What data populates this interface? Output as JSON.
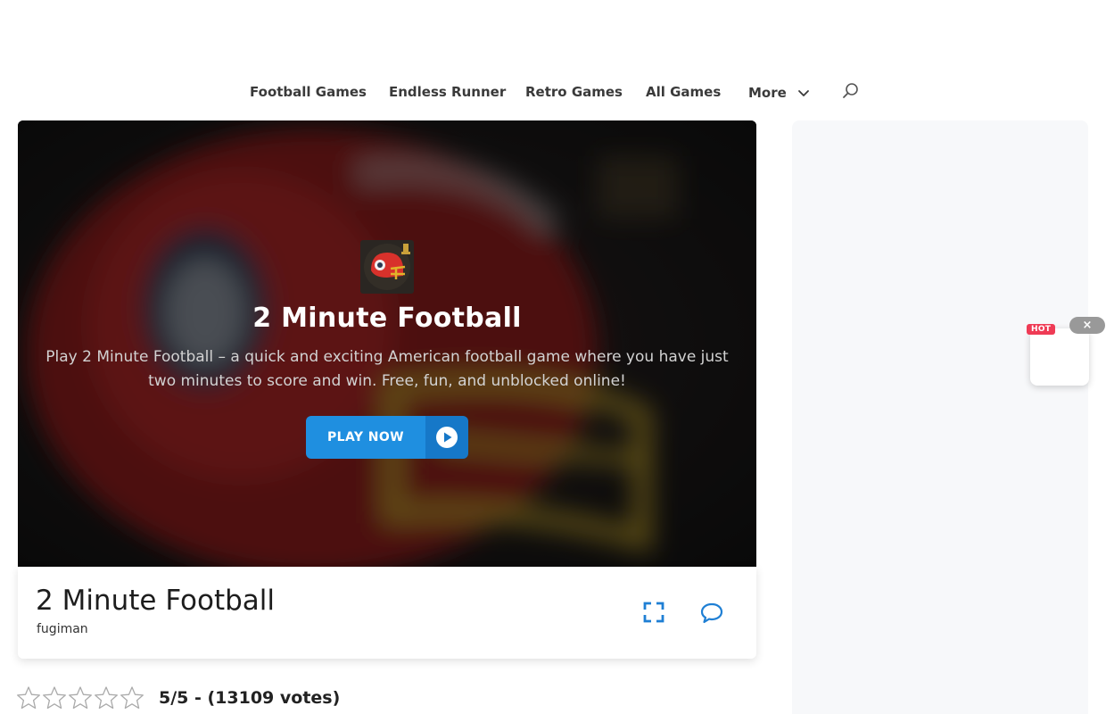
{
  "nav": {
    "items": [
      {
        "label": "Football Games"
      },
      {
        "label": "Endless Runner"
      },
      {
        "label": "Retro Games"
      },
      {
        "label": "All Games"
      }
    ],
    "more_label": "More"
  },
  "hero": {
    "title": "2 Minute Football",
    "description": "Play 2 Minute Football – a quick and exciting American football game where you have just two minutes to score and win. Free, fun, and unblocked online!",
    "play_label": "PLAY NOW"
  },
  "game": {
    "title": "2 Minute Football",
    "author": "fugiman"
  },
  "rating": {
    "text": "5/5 - (13109 votes)",
    "stars_filled": 0,
    "stars_total": 5
  },
  "widget": {
    "badge": "HOT",
    "close": "×"
  },
  "colors": {
    "accent": "#1f8fe0",
    "accent_dark": "#1678c8",
    "hot": "#ef3b55"
  },
  "icons": {
    "search": "search-icon",
    "chevron": "chevron-down-icon",
    "play": "play-circle-icon",
    "fullscreen": "fullscreen-icon",
    "comment": "comment-icon",
    "star": "star-outline-icon"
  }
}
